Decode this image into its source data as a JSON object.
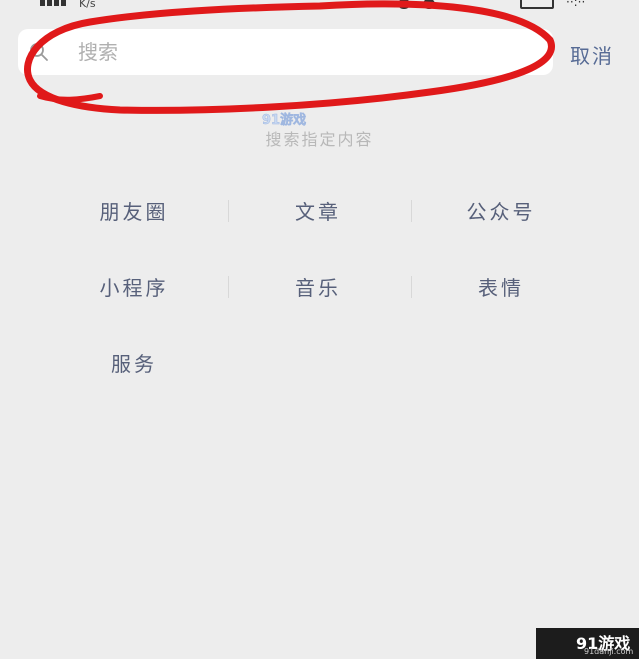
{
  "status_bar": {
    "net_speed": "K/s"
  },
  "search": {
    "placeholder": "搜索",
    "cancel_label": "取消"
  },
  "watermark": {
    "logo_text": "91游戏"
  },
  "hint": {
    "text": "搜索指定内容"
  },
  "categories": {
    "row1": [
      "朋友圈",
      "文章",
      "公众号"
    ],
    "row2": [
      "小程序",
      "音乐",
      "表情"
    ],
    "row3": [
      "服务"
    ]
  },
  "corner_badge": {
    "logo_text": "91游戏",
    "domain_text": "91danji.com"
  },
  "colors": {
    "background": "#ededed",
    "link_blue": "#576b95",
    "category_text": "#57607a",
    "annotation_red": "#e0191a"
  }
}
